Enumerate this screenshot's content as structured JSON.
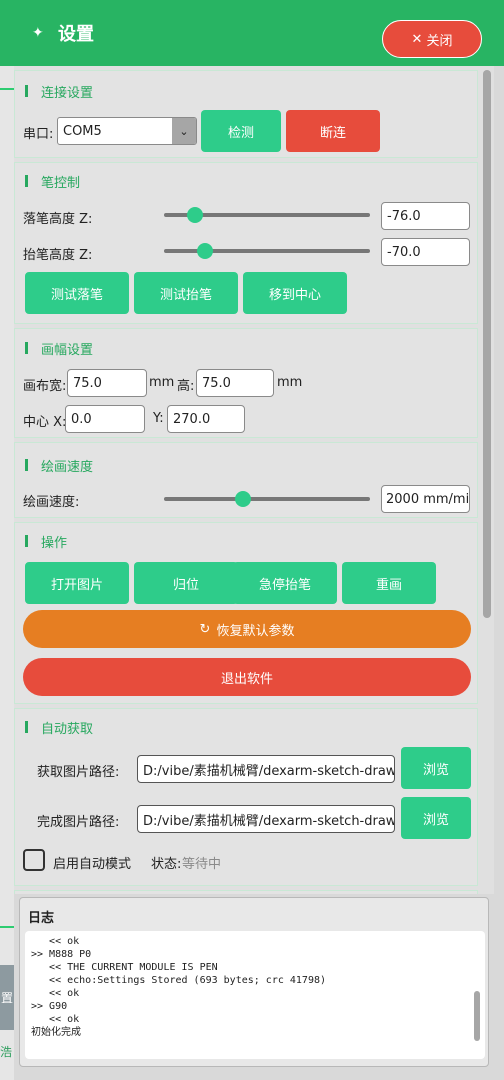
{
  "header": {
    "logo_glyph": "✦",
    "title": "设置",
    "close_icon": "✕",
    "close_label": "关闭"
  },
  "background": {
    "tab_text": "置",
    "tab_bottom_text": "浩"
  },
  "connection": {
    "title": "连接设置",
    "port_label": "串口:",
    "port_value": "COM5",
    "detect_button": "检测",
    "disconnect_button": "断连"
  },
  "pen": {
    "title": "笔控制",
    "down_label": "落笔高度 Z:",
    "down_value": "-76.0",
    "down_slider": 0.15,
    "up_label": "抬笔高度 Z:",
    "up_value": "-70.0",
    "up_slider": 0.2,
    "test_down_button": "测试落笔",
    "test_up_button": "测试抬笔",
    "center_button": "移到中心"
  },
  "canvas": {
    "title": "画幅设置",
    "width_label": "画布宽:",
    "width_value": "75.0",
    "mm1": "mm",
    "height_label": "高:",
    "height_value": "75.0",
    "mm2": "mm",
    "cx_label": "中心 X:",
    "cx_value": "0.0",
    "cy_label": "Y:",
    "cy_value": "270.0"
  },
  "speed": {
    "title": "绘画速度",
    "label": "绘画速度:",
    "value": "2000 mm/min",
    "slider": 0.385
  },
  "ops": {
    "title": "操作",
    "open_button": "打开图片",
    "home_button": "归位",
    "estop_button": "急停抬笔",
    "redraw_button": "重画",
    "reset_icon": "↻",
    "reset_button": "恢复默认参数",
    "exit_button": "退出软件"
  },
  "auto": {
    "title": "自动获取",
    "fetch_label": "获取图片路径:",
    "fetch_value": "D:/vibe/素描机械臂/dexarm-sketch-drawer/",
    "fetch_browse": "浏览",
    "done_label": "完成图片路径:",
    "done_value": "D:/vibe/素描机械臂/dexarm-sketch-drawer/",
    "done_browse": "浏览",
    "auto_mode_label": "启用自动模式",
    "status_label": "状态:",
    "status_value": "等待中"
  },
  "log": {
    "title": "日志",
    "lines": [
      "   << ok",
      ">> M888 P0",
      "   << THE CURRENT MODULE IS PEN",
      "   << echo:Settings Stored (693 bytes; crc 41798)",
      "   << ok",
      ">> G90",
      "   << ok",
      "初始化完成"
    ]
  },
  "colors": {
    "header": "#28b463",
    "primary_button": "#2ecc8a",
    "danger_button": "#e74c3c",
    "warning_button": "#e67e22",
    "section_title": "#27a85f"
  }
}
